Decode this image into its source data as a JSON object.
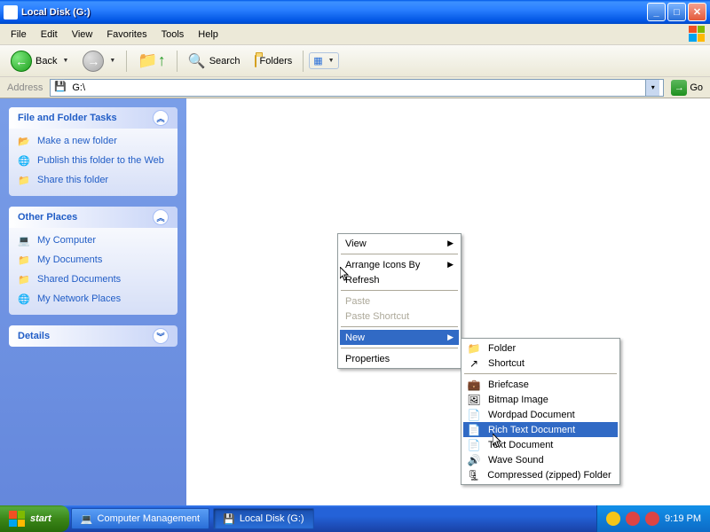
{
  "window": {
    "title": "Local Disk (G:)"
  },
  "menubar": [
    "File",
    "Edit",
    "View",
    "Favorites",
    "Tools",
    "Help"
  ],
  "toolbar": {
    "back": "Back",
    "search": "Search",
    "folders": "Folders"
  },
  "addressbar": {
    "label": "Address",
    "value": "G:\\",
    "go": "Go"
  },
  "sidebar": {
    "tasks": {
      "title": "File and Folder Tasks",
      "items": [
        "Make a new folder",
        "Publish this folder to the Web",
        "Share this folder"
      ]
    },
    "places": {
      "title": "Other Places",
      "items": [
        "My Computer",
        "My Documents",
        "Shared Documents",
        "My Network Places"
      ]
    },
    "details": {
      "title": "Details"
    }
  },
  "context_menu": {
    "view": "View",
    "arrange": "Arrange Icons By",
    "refresh": "Refresh",
    "paste": "Paste",
    "paste_shortcut": "Paste Shortcut",
    "new": "New",
    "properties": "Properties"
  },
  "new_submenu": {
    "folder": "Folder",
    "shortcut": "Shortcut",
    "briefcase": "Briefcase",
    "bitmap": "Bitmap Image",
    "wordpad": "Wordpad Document",
    "rtf": "Rich Text Document",
    "text": "Text Document",
    "wave": "Wave Sound",
    "zip": "Compressed (zipped) Folder"
  },
  "taskbar": {
    "start": "start",
    "items": [
      "Computer Management",
      "Local Disk (G:)"
    ],
    "clock": "9:19 PM"
  }
}
